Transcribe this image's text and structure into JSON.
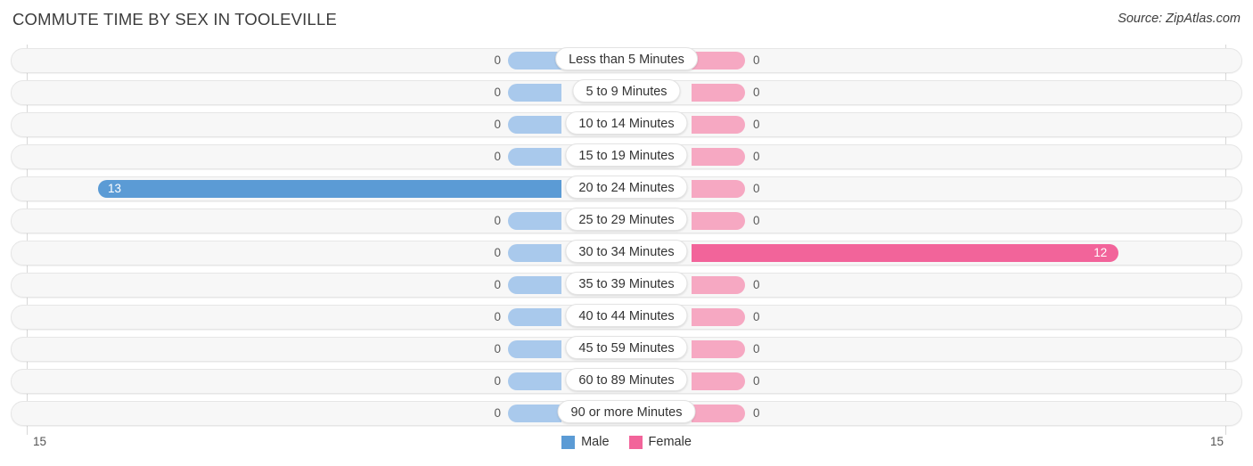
{
  "header": {
    "title": "COMMUTE TIME BY SEX IN TOOLEVILLE",
    "source": "Source: ZipAtlas.com"
  },
  "legend": {
    "male_label": "Male",
    "female_label": "Female",
    "male_color": "#5b9bd5",
    "female_color": "#f2649a"
  },
  "axis": {
    "left_tick": "15",
    "right_tick": "15",
    "max": 15
  },
  "chart_data": {
    "type": "bar",
    "orientation": "horizontal-diverging",
    "title": "COMMUTE TIME BY SEX IN TOOLEVILLE",
    "xlabel": "",
    "ylabel": "",
    "xlim": [
      15,
      15
    ],
    "grid": false,
    "legend_position": "bottom-center",
    "categories": [
      "Less than 5 Minutes",
      "5 to 9 Minutes",
      "10 to 14 Minutes",
      "15 to 19 Minutes",
      "20 to 24 Minutes",
      "25 to 29 Minutes",
      "30 to 34 Minutes",
      "35 to 39 Minutes",
      "40 to 44 Minutes",
      "45 to 59 Minutes",
      "60 to 89 Minutes",
      "90 or more Minutes"
    ],
    "series": [
      {
        "name": "Male",
        "color": "#5b9bd5",
        "values": [
          0,
          0,
          0,
          0,
          13,
          0,
          0,
          0,
          0,
          0,
          0,
          0
        ]
      },
      {
        "name": "Female",
        "color": "#f2649a",
        "values": [
          0,
          0,
          0,
          0,
          0,
          0,
          12,
          0,
          0,
          0,
          0,
          0
        ]
      }
    ],
    "male_labels": [
      "0",
      "0",
      "0",
      "0",
      "13",
      "0",
      "0",
      "0",
      "0",
      "0",
      "0",
      "0"
    ],
    "female_labels": [
      "0",
      "0",
      "0",
      "0",
      "0",
      "0",
      "12",
      "0",
      "0",
      "0",
      "0",
      "0"
    ]
  }
}
